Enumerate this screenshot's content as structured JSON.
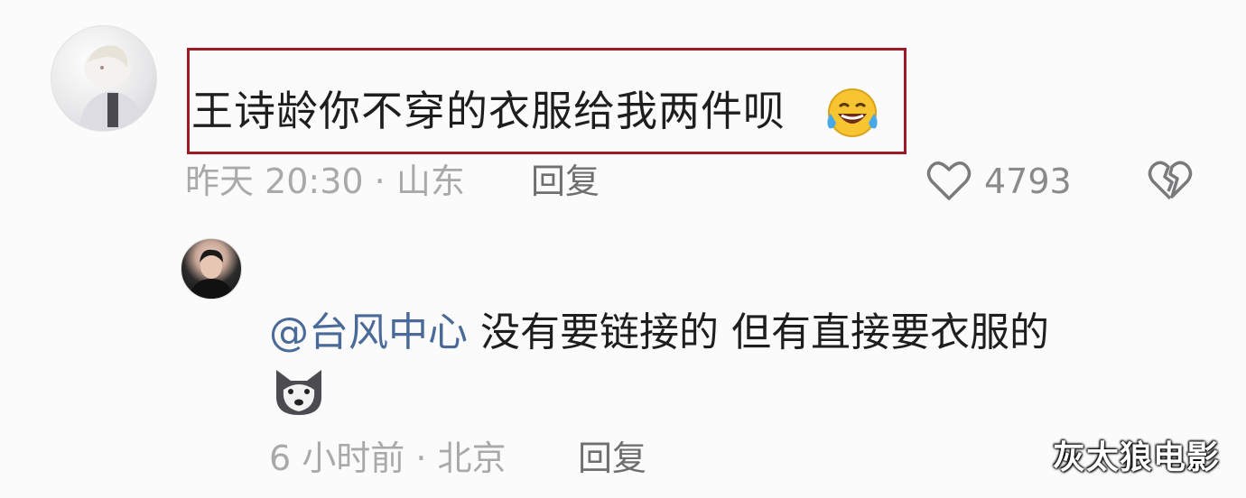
{
  "comment1": {
    "text": "王诗龄你不穿的衣服给我两件呗",
    "emoji": "laughing-crying-emoji",
    "meta": "昨天 20:30 · 山东",
    "reply_label": "回复",
    "like_count": "4793"
  },
  "comment2": {
    "mention": "@台风中心",
    "text": " 没有要链接的 但有直接要衣服的",
    "emoji": "husky-dog-emoji",
    "meta": "6 小时前 · 北京",
    "reply_label": "回复"
  },
  "watermark": "灰太狼电影",
  "colors": {
    "highlight_border": "#9e1b26",
    "mention": "#4a6a98",
    "meta_text": "#a9a9ab"
  }
}
